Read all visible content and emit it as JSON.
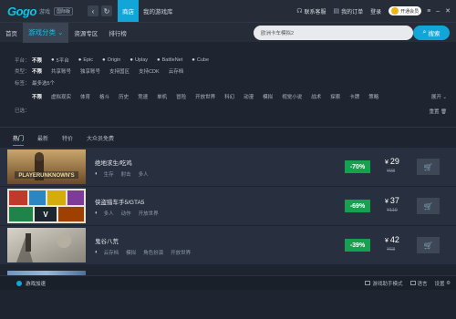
{
  "titlebar": {
    "logo": "Gogo",
    "logo_sub": "游戏",
    "version_badge": "国际版",
    "back_icon": "chevron-left-icon",
    "refresh_icon": "refresh-icon",
    "tabs": [
      {
        "label": "商店",
        "active": true
      },
      {
        "label": "我的游戏库",
        "active": false
      }
    ],
    "support": "联系客服",
    "orders": "我的订单",
    "login": "登录",
    "vip": "开通会员"
  },
  "subbar": {
    "items": [
      {
        "label": "首页",
        "active": false
      },
      {
        "label": "游戏分类",
        "active": true
      },
      {
        "label": "资源专区",
        "active": false
      },
      {
        "label": "排行榜",
        "active": false
      }
    ],
    "search_value": "欧洲卡车模拟2",
    "search_button": "搜索"
  },
  "filters": {
    "platform_label": "平台：",
    "platforms": [
      "不限",
      "5平台",
      "Epic",
      "Origin",
      "Uplay",
      "BattleNet",
      "Cube"
    ],
    "type_label": "类型：",
    "types": [
      "不限",
      "共享账号",
      "独享账号",
      "支持国区",
      "支持CDK",
      "云存档"
    ],
    "tags_label": "标签：",
    "tags_hint": "最多选5个",
    "tags": [
      "不限",
      "虚拟现实",
      "体育",
      "格斗",
      "历史",
      "竞速",
      "单机",
      "冒险",
      "开放世界",
      "科幻",
      "动漫",
      "模拟",
      "视觉小说",
      "战术",
      "探索",
      "卡牌",
      "策略"
    ],
    "expand": "展开",
    "selected_label": "已选：",
    "reset": "重置"
  },
  "sort_tabs": [
    {
      "label": "热门",
      "active": true
    },
    {
      "label": "最新",
      "active": false
    },
    {
      "label": "特价",
      "active": false
    },
    {
      "label": "大众员免费",
      "active": false
    }
  ],
  "games": [
    {
      "title": "绝地求生/吃鸡",
      "tags": [
        "生存",
        "射击",
        "多人"
      ],
      "discount": "-70%",
      "currency": "¥",
      "price": "29",
      "original_price": "¥98"
    },
    {
      "title": "侠盗猎车手5/GTA5",
      "tags": [
        "多人",
        "动作",
        "开放世界"
      ],
      "discount": "-69%",
      "currency": "¥",
      "price": "37",
      "original_price": "¥119"
    },
    {
      "title": "鬼谷八荒",
      "tags": [
        "云存档",
        "模拟",
        "角色扮演",
        "开放世界"
      ],
      "discount": "-39%",
      "currency": "¥",
      "price": "42",
      "original_price": "¥68"
    }
  ],
  "statusbar": {
    "accelerate": "游戏加速",
    "mini_mode": "游戏助手模式",
    "language": "语言",
    "settings": "设置"
  }
}
